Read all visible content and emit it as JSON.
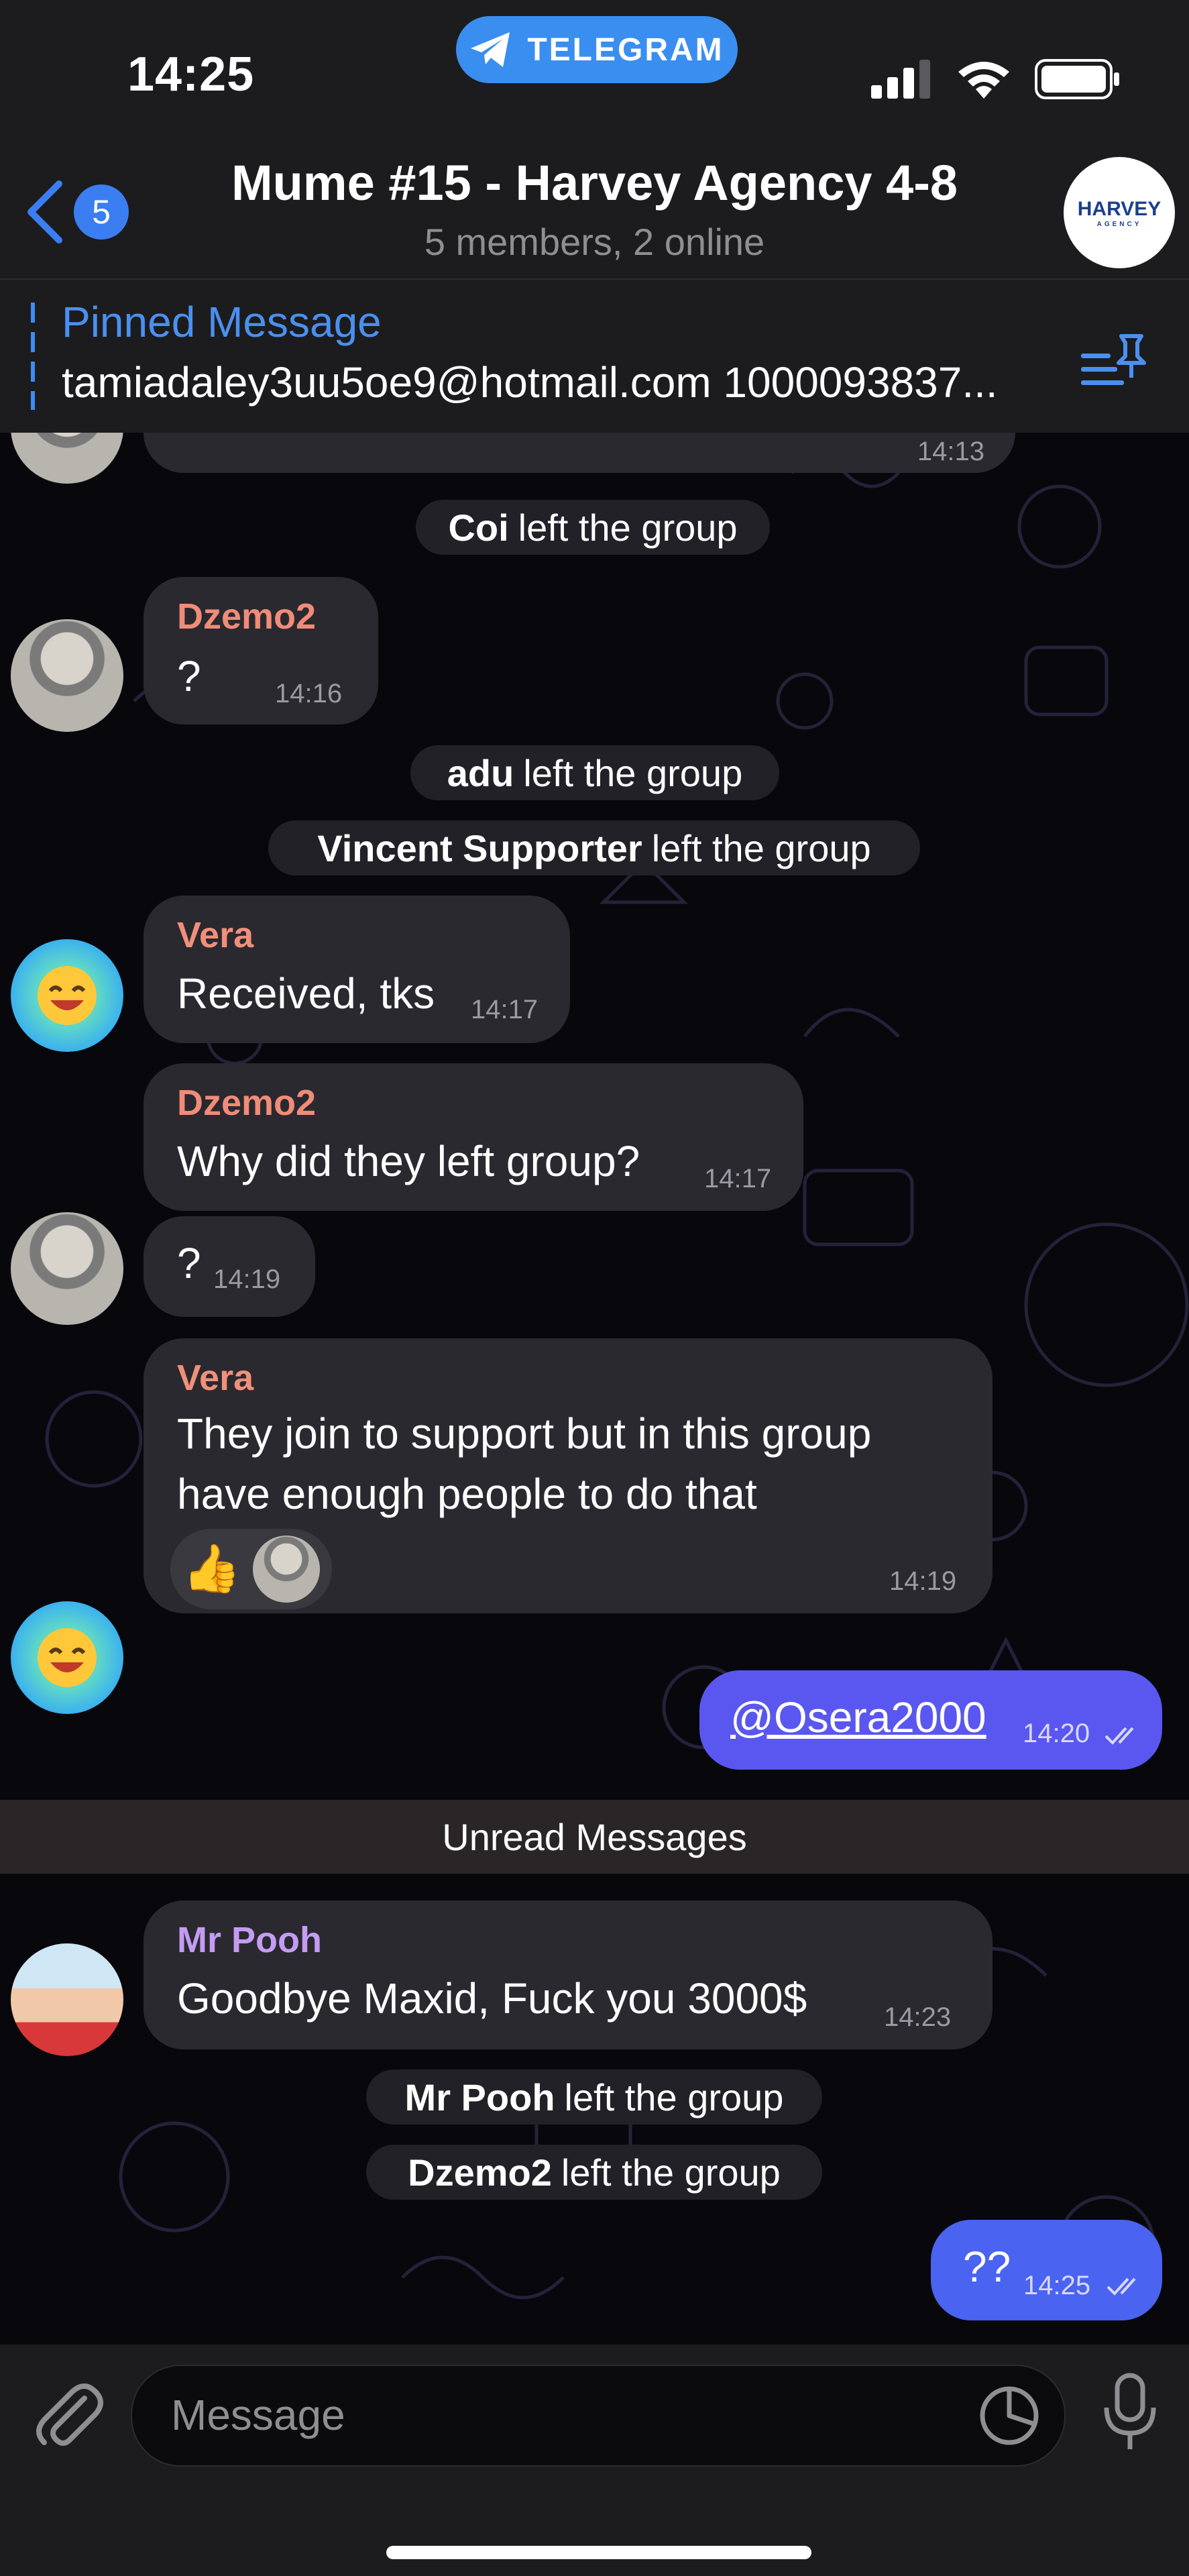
{
  "status_bar": {
    "time": "14:25",
    "app_pill_label": "TELEGRAM",
    "icons": [
      "signal-icon",
      "wifi-icon",
      "battery-icon"
    ]
  },
  "header": {
    "back_badge": "5",
    "title": "Mume #15 - Harvey Agency 4-8",
    "subtitle": "5 members, 2 online",
    "avatar_text": "HARVEY",
    "avatar_subtext": "AGENCY"
  },
  "pinned": {
    "title": "Pinned Message",
    "text": "tamiadaley3uu5oe9@hotmail.com 1000093837..."
  },
  "messages": {
    "m0": {
      "time": "14:13"
    },
    "s1": {
      "name": "Coi",
      "action": "left the group"
    },
    "m1": {
      "sender": "Dzemo2",
      "text": "?",
      "time": "14:16"
    },
    "s2": {
      "name": "adu",
      "action": "left the group"
    },
    "s3": {
      "name": "Vincent Supporter",
      "action": "left the group"
    },
    "m2": {
      "sender": "Vera",
      "text": "Received, tks",
      "time": "14:17"
    },
    "m3": {
      "sender": "Dzemo2",
      "text": "Why did they left group?",
      "time": "14:17"
    },
    "m4": {
      "text": "?",
      "time": "14:19"
    },
    "m5": {
      "sender": "Vera",
      "line1": "They join to support but in this group",
      "line2": "have enough people to do that",
      "time": "14:19",
      "reaction": "👍"
    },
    "m6": {
      "text": "@Osera2000",
      "time": "14:20"
    },
    "unread": "Unread Messages",
    "m7": {
      "sender": "Mr Pooh",
      "text": "Goodbye Maxid, Fuck you 3000$",
      "time": "14:23"
    },
    "s4": {
      "name": "Mr Pooh",
      "action": "left the group"
    },
    "s5": {
      "name": "Dzemo2",
      "action": "left the group"
    },
    "m8": {
      "text": "??",
      "time": "14:25"
    }
  },
  "input": {
    "placeholder": "Message"
  },
  "colors": {
    "accent": "#3b7ef2",
    "dzemo": "#f08c78",
    "vera": "#f0907a",
    "pooh": "#c49cf2",
    "outgoing": "#5a57f0"
  }
}
